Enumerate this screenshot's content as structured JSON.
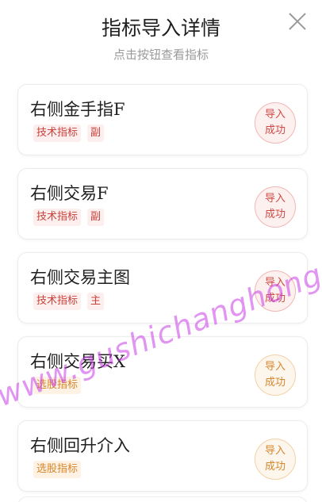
{
  "header": {
    "title": "指标导入详情",
    "subtitle": "点击按钮查看指标"
  },
  "items": [
    {
      "name": "右侧金手指F",
      "tags": [
        "技术指标",
        "副"
      ],
      "status_line1": "导入",
      "status_line2": "成功",
      "tag_style": "red",
      "badge_style": "red"
    },
    {
      "name": "右侧交易F",
      "tags": [
        "技术指标",
        "副"
      ],
      "status_line1": "导入",
      "status_line2": "成功",
      "tag_style": "red",
      "badge_style": "red"
    },
    {
      "name": "右侧交易主图",
      "tags": [
        "技术指标",
        "主"
      ],
      "status_line1": "导入",
      "status_line2": "成功",
      "tag_style": "red",
      "badge_style": "red"
    },
    {
      "name": "右侧交易买X",
      "tags": [
        "选股指标"
      ],
      "status_line1": "导入",
      "status_line2": "成功",
      "tag_style": "orange",
      "badge_style": "orange"
    },
    {
      "name": "右侧回升介入",
      "tags": [
        "选股指标"
      ],
      "status_line1": "导入",
      "status_line2": "成功",
      "tag_style": "orange",
      "badge_style": "orange"
    }
  ],
  "watermark": "www.gushichanghong.com",
  "colors": {
    "tag_red_bg": "#fcefee",
    "tag_red_text": "#c9413a",
    "tag_orange_bg": "#fdf2e4",
    "tag_orange_text": "#d8862a",
    "watermark": "#c83ce6"
  }
}
